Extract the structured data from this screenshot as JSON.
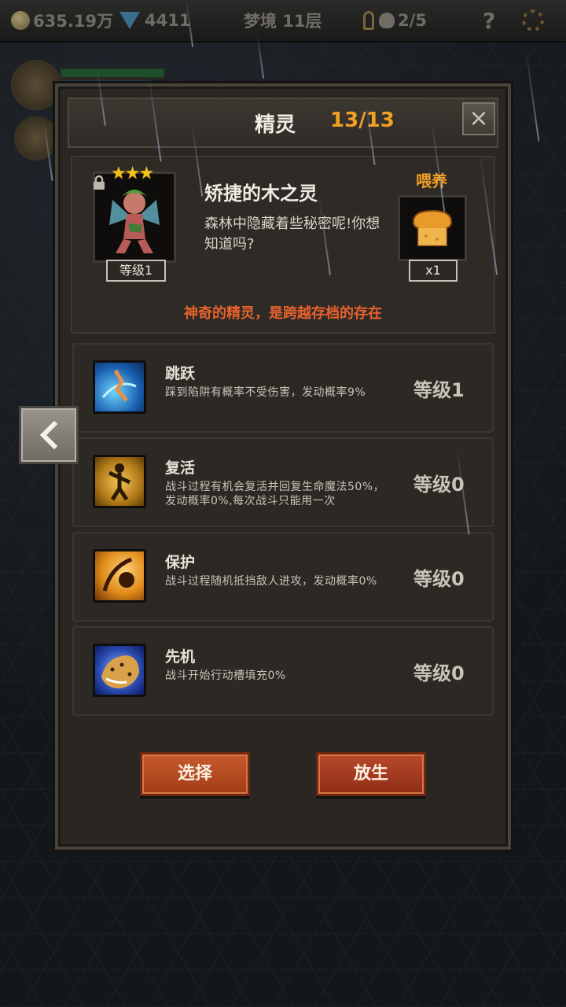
{
  "hud": {
    "gold": "635.19万",
    "gems": "4411",
    "floor": "梦境 11层",
    "keys": "2/5",
    "help": "?"
  },
  "panel": {
    "title": "精灵",
    "count": "13/13",
    "close": "×"
  },
  "spirit": {
    "name": "矫捷的木之灵",
    "stars": "★★★",
    "level": "等级1",
    "description": "森林中隐藏着些秘密呢!你想知道吗?",
    "feed_label": "喂养",
    "food_count": "x1",
    "tagline": "神奇的精灵，是跨越存档的存在"
  },
  "skills": [
    {
      "name": "跳跃",
      "desc": "踩到陷阱有概率不受伤害，发动概率9%",
      "level": "等级1"
    },
    {
      "name": "复活",
      "desc": "战斗过程有机会复活并回复生命魔法50%，发动概率0%,每次战斗只能用一次",
      "level": "等级0"
    },
    {
      "name": "保护",
      "desc": "战斗过程随机抵挡敌人进攻，发动概率0%",
      "level": "等级0"
    },
    {
      "name": "先机",
      "desc": "战斗开始行动槽填充0%",
      "level": "等级0"
    }
  ],
  "buttons": {
    "select": "选择",
    "release": "放生"
  }
}
